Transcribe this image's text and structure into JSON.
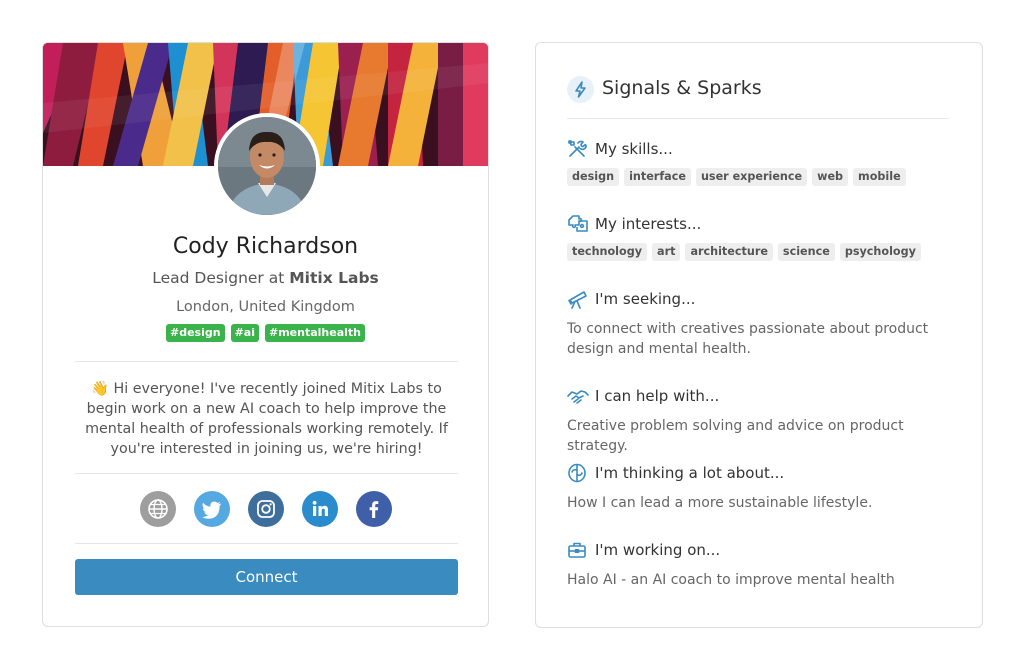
{
  "profile": {
    "name": "Cody Richardson",
    "role_prefix": "Lead Designer at ",
    "company": "Mitix Labs",
    "location": "London, United Kingdom",
    "tags": [
      "#design",
      "#ai",
      "#mentalhealth"
    ],
    "bio": "👋 Hi everyone! I've recently joined Mitix Labs to begin work on a new AI coach to help improve the mental health of professionals working remotely. If you're interested in joining us, we're hiring!",
    "socials": [
      {
        "icon": "globe-icon",
        "color": "#9e9e9e"
      },
      {
        "icon": "twitter-icon",
        "color": "#55a8e0"
      },
      {
        "icon": "instagram-icon",
        "color": "#3e6f9c"
      },
      {
        "icon": "linkedin-icon",
        "color": "#2a8ccc"
      },
      {
        "icon": "facebook-icon",
        "color": "#3f5fa8"
      }
    ],
    "connect_label": "Connect",
    "accent_color": "#3a8bc0",
    "tag_color": "#3ab34a"
  },
  "signals": {
    "title": "Signals & Sparks",
    "skills": {
      "icon": "tools-icon",
      "title": "My skills...",
      "chips": [
        "design",
        "interface",
        "user experience",
        "web",
        "mobile"
      ]
    },
    "interests": {
      "icon": "puzzle-icon",
      "title": "My interests...",
      "chips": [
        "technology",
        "art",
        "architecture",
        "science",
        "psychology"
      ]
    },
    "seeking": {
      "icon": "telescope-icon",
      "title": "I'm seeking...",
      "text": "To connect with creatives passionate about product design and mental health."
    },
    "help": {
      "icon": "handshake-icon",
      "title": "I can help with...",
      "text": "Creative problem solving and advice on product strategy."
    },
    "thinking": {
      "icon": "brain-icon",
      "title": "I'm thinking a lot about...",
      "text": "How I can lead a more sustainable lifestyle."
    },
    "working": {
      "icon": "briefcase-icon",
      "title": "I'm working on...",
      "text": "Halo AI - an AI coach to improve mental health"
    },
    "icon_color": "#3a8bc0"
  }
}
